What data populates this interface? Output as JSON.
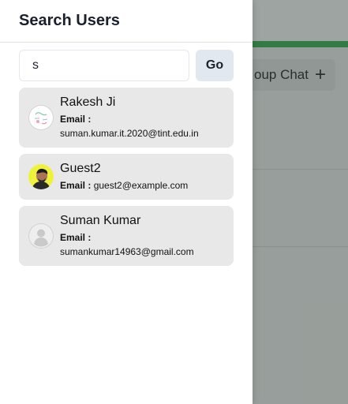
{
  "drawer": {
    "title": "Search Users"
  },
  "search": {
    "value": "s",
    "go_label": "Go"
  },
  "users": [
    {
      "name": "Rakesh Ji",
      "email_label": "Email :",
      "email": "suman.kumar.it.2020@tint.edu.in",
      "avatar": "sketch-avatar"
    },
    {
      "name": "Guest2",
      "email_label": "Email :",
      "email": "guest2@example.com",
      "avatar": "photo-avatar"
    },
    {
      "name": "Suman Kumar",
      "email_label": "Email :",
      "email": "sumankumar14963@gmail.com",
      "avatar": "default-avatar"
    }
  ],
  "background": {
    "group_chat_label": "oup Chat"
  },
  "colors": {
    "accent_green": "#2fb34f",
    "card_bg": "#e8e8e8",
    "button_bg": "#e2e8f0"
  }
}
